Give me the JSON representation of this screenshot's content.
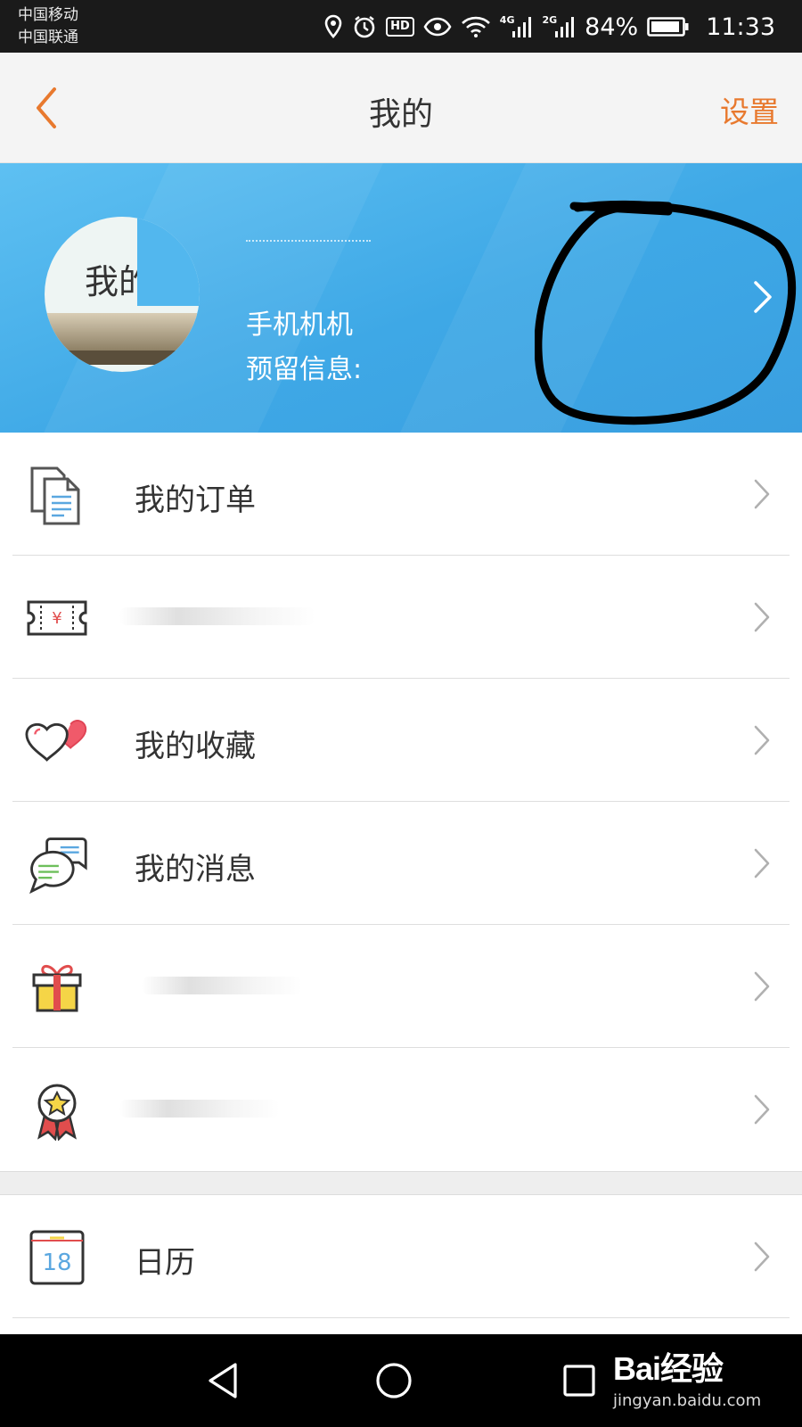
{
  "status_bar": {
    "carrier_1": "中国移动",
    "carrier_2": "中国联通",
    "hd": "HD",
    "network_1": "4G",
    "network_2": "2G",
    "battery_percent": "84%",
    "time": "11:33",
    "icons": [
      "location-icon",
      "alarm-icon",
      "hd-icon",
      "eye-icon",
      "wifi-icon",
      "signal-icon",
      "battery-icon"
    ]
  },
  "header": {
    "title": "我的",
    "settings_label": "设置",
    "back_icon": "chevron-left-icon"
  },
  "profile": {
    "avatar_text": "我的",
    "phone_label": "手机机机",
    "reserved_label": "预留信息:"
  },
  "menu": {
    "items": [
      {
        "label": "我的订单",
        "icon": "document-icon"
      },
      {
        "label": "",
        "icon": "ticket-icon"
      },
      {
        "label": "我的收藏",
        "icon": "hearts-icon"
      },
      {
        "label": "我的消息",
        "icon": "chat-icon"
      },
      {
        "label": "",
        "icon": "gift-icon"
      },
      {
        "label": "",
        "icon": "medal-icon"
      }
    ],
    "secondary": [
      {
        "label": "日历",
        "icon": "calendar-icon",
        "calendar_day": "18"
      }
    ]
  },
  "watermark": {
    "logo": "Bai经验",
    "url": "jingyan.baidu.com"
  },
  "colors": {
    "accent": "#e8792e",
    "banner": "#4ab2ea",
    "text": "#333333",
    "divider": "#dedede"
  }
}
